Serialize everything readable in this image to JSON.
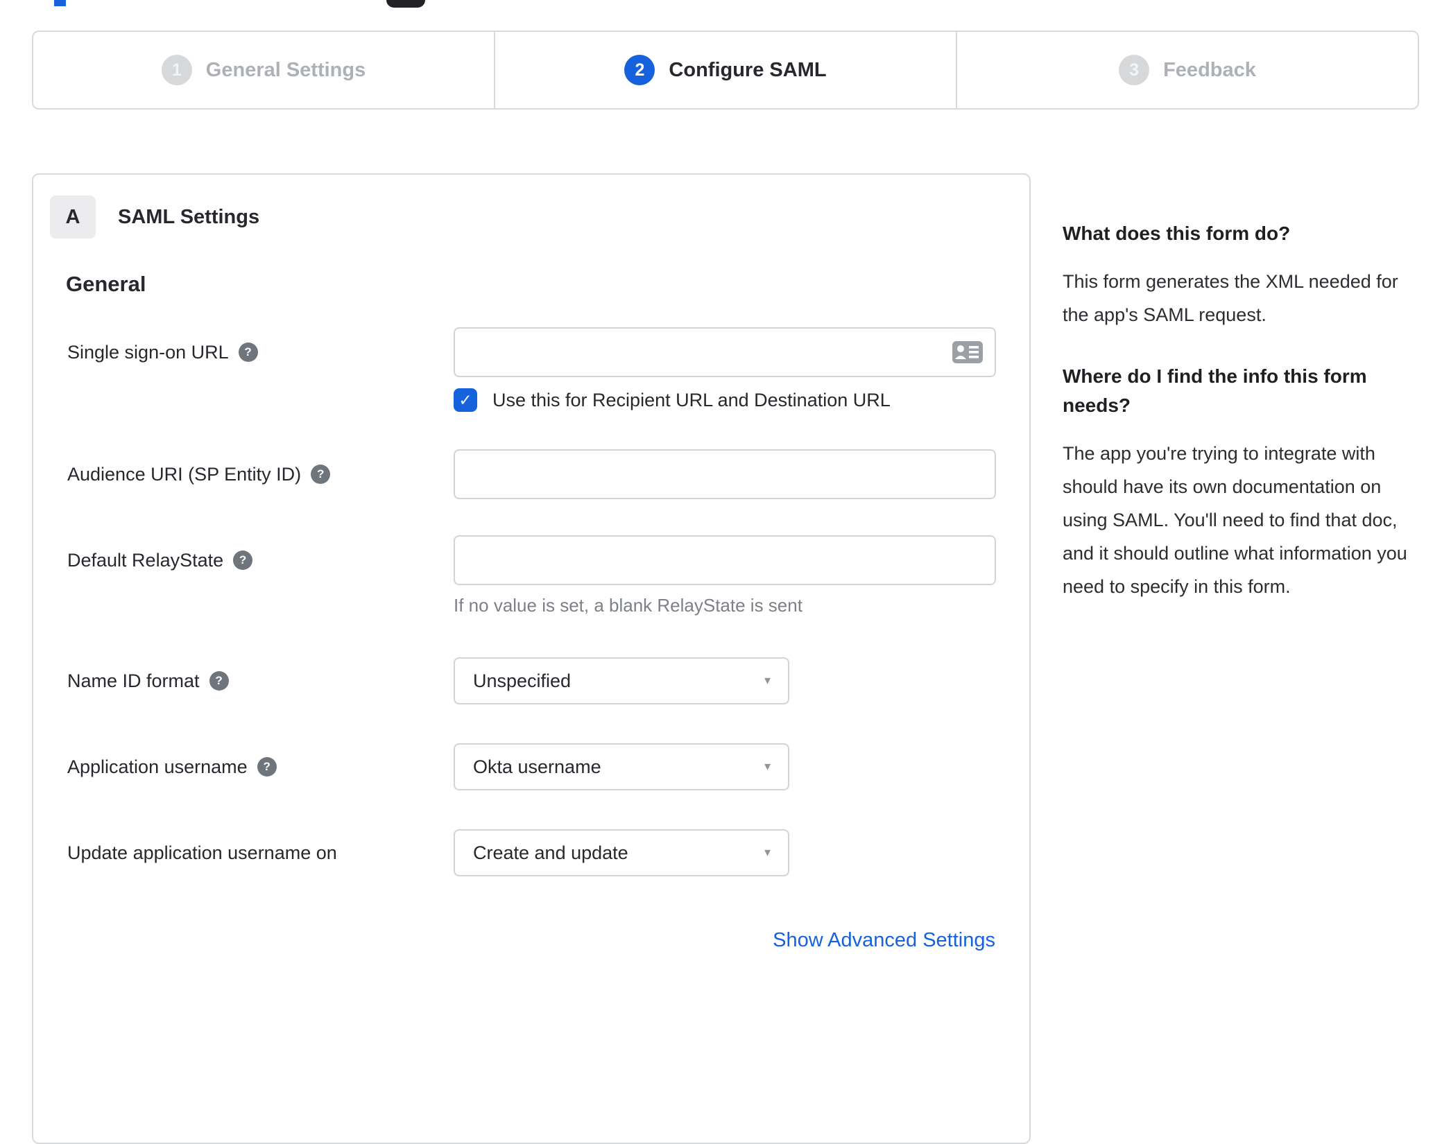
{
  "colors": {
    "accent": "#1662dd"
  },
  "stepper": {
    "steps": [
      {
        "number": "1",
        "label": "General Settings",
        "state": "inactive"
      },
      {
        "number": "2",
        "label": "Configure SAML",
        "state": "active"
      },
      {
        "number": "3",
        "label": "Feedback",
        "state": "inactive"
      }
    ]
  },
  "form": {
    "badge": "A",
    "title": "SAML Settings",
    "section": "General",
    "help_icon_glyph": "?",
    "checkbox_glyph": "✓",
    "select_caret": "▼",
    "fields": [
      {
        "label": "Single sign-on URL",
        "type": "text",
        "value": "",
        "checkbox_checked": true,
        "checkbox_label": "Use this for Recipient URL and Destination URL"
      },
      {
        "label": "Audience URI (SP Entity ID)",
        "type": "text",
        "value": ""
      },
      {
        "label": "Default RelayState",
        "type": "text",
        "value": "",
        "helper": "If no value is set, a blank RelayState is sent"
      },
      {
        "label": "Name ID format",
        "type": "select",
        "value": "Unspecified"
      },
      {
        "label": "Application username",
        "type": "select",
        "value": "Okta username"
      },
      {
        "label": "Update application username on",
        "type": "select",
        "value": "Create and update"
      }
    ],
    "advanced_link": "Show Advanced Settings"
  },
  "help_panel": {
    "sections": [
      {
        "heading": "What does this form do?",
        "body": "This form generates the XML needed for the app's SAML request."
      },
      {
        "heading": "Where do I find the info this form needs?",
        "body": "The app you're trying to integrate with should have its own documentation on using SAML. You'll need to find that doc, and it should outline what information you need to specify in this form."
      }
    ]
  }
}
